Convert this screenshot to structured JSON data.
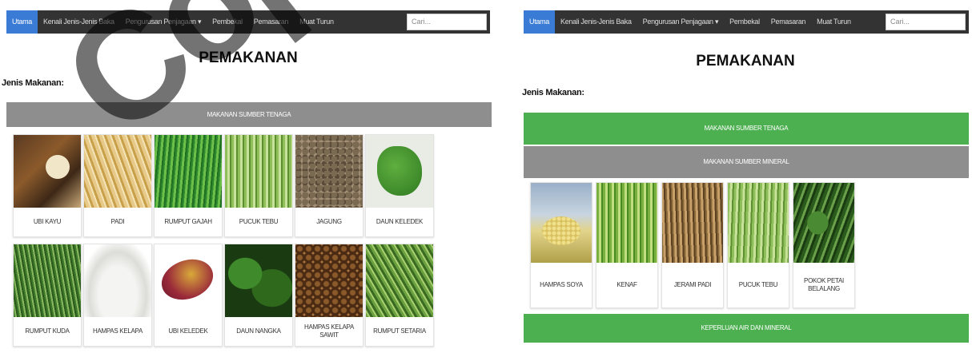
{
  "left": {
    "nav": [
      "Utama",
      "Kenali Jenis-Jenis Baka",
      "Pengurusan Penjagaan ▾",
      "Pembekal",
      "Pemasaran",
      "Muat Turun"
    ],
    "search_placeholder": "Cari...",
    "title": "PEMAKANAN",
    "section": "Jenis Makanan:",
    "bar": "MAKANAN SUMBER TENAGA",
    "items": [
      "UBI KAYU",
      "PADI",
      "RUMPUT GAJAH",
      "PUCUK TEBU",
      "JAGUNG",
      "DAUN KELEDEK",
      "RUMPUT KUDA",
      "HAMPAS KELAPA",
      "UBI KELEDEK",
      "DAUN NANGKA",
      "HAMPAS KELAPA SAWIT",
      "RUMPUT SETARIA"
    ]
  },
  "right": {
    "nav": [
      "Utama",
      "Kenali Jenis-Jenis Baka",
      "Pengurusan Penjagaan ▾",
      "Pembekal",
      "Pemasaran",
      "Muat Turun"
    ],
    "search_placeholder": "Cari...",
    "title": "PEMAKANAN",
    "section": "Jenis Makanan:",
    "bars": [
      "MAKANAN SUMBER TENAGA",
      "MAKANAN SUMBER MINERAL",
      "KEPERLUAN AIR DAN MINERAL"
    ],
    "items": [
      "HAMPAS SOYA",
      "KENAF",
      "JERAMI PADI",
      "PUCUK TEBU",
      "POKOK PETAI BELALANG"
    ]
  },
  "watermark": "Copy",
  "colors": {
    "navbar": "#333333",
    "active_nav": "#3a7bd5",
    "gray_bar": "#8e8e8e",
    "green_bar": "#4caf50"
  }
}
